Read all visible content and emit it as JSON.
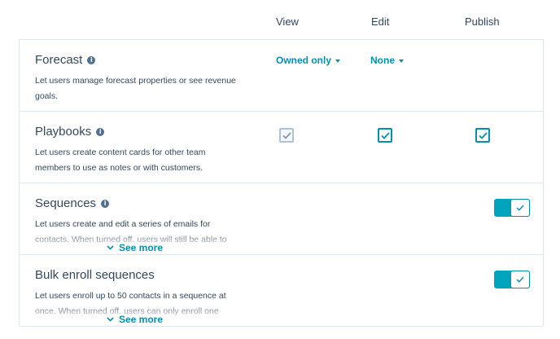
{
  "columns": {
    "view": "View",
    "edit": "Edit",
    "publish": "Publish"
  },
  "info_glyph": "i",
  "see_more_label": "See more",
  "colors": {
    "accent": "#0091ae",
    "toggle_on": "#00a4bd",
    "border": "#dfe3eb",
    "text": "#33475b"
  },
  "rows": [
    {
      "title": "Forecast",
      "description": "Let users manage forecast properties or see revenue goals.",
      "view_value": "Owned only",
      "edit_value": "None"
    },
    {
      "title": "Playbooks",
      "description": "Let users create content cards for other team members to use as notes or with customers.",
      "view_checked": true,
      "view_disabled": true,
      "edit_checked": true,
      "publish_checked": true
    },
    {
      "title": "Sequences",
      "description": "Let users create and edit a series of emails for contacts. When turned off, users will still be able to",
      "toggle_on": true
    },
    {
      "title": "Bulk enroll sequences",
      "description": "Let users enroll up to 50 contacts in a sequence at once. When turned off, users can only enroll one",
      "toggle_on": true
    }
  ]
}
